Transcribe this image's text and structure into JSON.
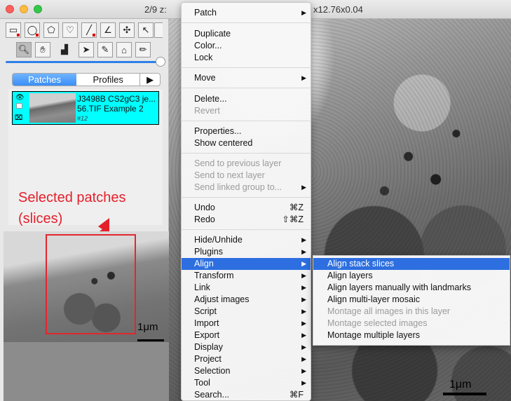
{
  "window": {
    "title_left": "2/9  z:",
    "title_right": "x12.76x0.04"
  },
  "toolbar": {
    "tools_row1": [
      "rectangle-tool",
      "oval-tool",
      "polygon-tool",
      "freehand-tool",
      "line-tool",
      "angle-tool",
      "point-tool",
      "arrow-tool"
    ],
    "tools_row2": [
      "magnifier-tool",
      "hand-tool",
      "align-tool",
      "select-tool",
      "pencil-tool",
      "fill-tool",
      "brush-tool"
    ]
  },
  "tabs": {
    "patches": "Patches",
    "profiles": "Profiles",
    "more": "▶"
  },
  "patch": {
    "name_line1": "J3498B CS2gC3 je...",
    "name_line2": "56.TIF Example 2",
    "id": "#12"
  },
  "annotation": {
    "line1": "Selected patches",
    "line2": "(slices)",
    "color": "#e4202b"
  },
  "scalebar_label": "1μm",
  "menu": {
    "items": [
      {
        "label": "Patch",
        "arrow": "▶"
      },
      {
        "label": "Duplicate"
      },
      {
        "label": "Color..."
      },
      {
        "label": "Lock"
      },
      {
        "label": "Move",
        "arrow": "▶"
      },
      {
        "label": "Delete..."
      },
      {
        "label": "Revert",
        "disabled": true
      },
      {
        "label": "Properties..."
      },
      {
        "label": "Show centered"
      },
      {
        "label": "Send to previous layer",
        "disabled": true
      },
      {
        "label": "Send to next layer",
        "disabled": true
      },
      {
        "label": "Send linked group to...",
        "disabled": true,
        "arrow": "▶"
      },
      {
        "label": "Undo",
        "shortcut": "⌘Z"
      },
      {
        "label": "Redo",
        "shortcut": "⇧⌘Z"
      },
      {
        "label": "Hide/Unhide",
        "arrow": "▶"
      },
      {
        "label": "Plugins",
        "arrow": "▶"
      },
      {
        "label": "Align",
        "arrow": "▶",
        "highlighted": true
      },
      {
        "label": "Transform",
        "arrow": "▶"
      },
      {
        "label": "Link",
        "arrow": "▶"
      },
      {
        "label": "Adjust images",
        "arrow": "▶"
      },
      {
        "label": "Script",
        "arrow": "▶"
      },
      {
        "label": "Import",
        "arrow": "▶"
      },
      {
        "label": "Export",
        "arrow": "▶"
      },
      {
        "label": "Display",
        "arrow": "▶"
      },
      {
        "label": "Project",
        "arrow": "▶"
      },
      {
        "label": "Selection",
        "arrow": "▶"
      },
      {
        "label": "Tool",
        "arrow": "▶"
      },
      {
        "label": "Search...",
        "shortcut": "⌘F"
      }
    ]
  },
  "submenu": {
    "items": [
      {
        "label": "Align stack slices",
        "highlighted": true
      },
      {
        "label": "Align layers"
      },
      {
        "label": "Align layers manually with landmarks"
      },
      {
        "label": "Align multi-layer mosaic"
      },
      {
        "label": "Montage all images in this layer",
        "disabled": true
      },
      {
        "label": "Montage selected images",
        "disabled": true
      },
      {
        "label": "Montage multiple layers"
      }
    ]
  },
  "colors": {
    "highlight": "#2d6fe0",
    "patch_selected": "#00ffff",
    "tab_active": "#3a8ef6"
  }
}
